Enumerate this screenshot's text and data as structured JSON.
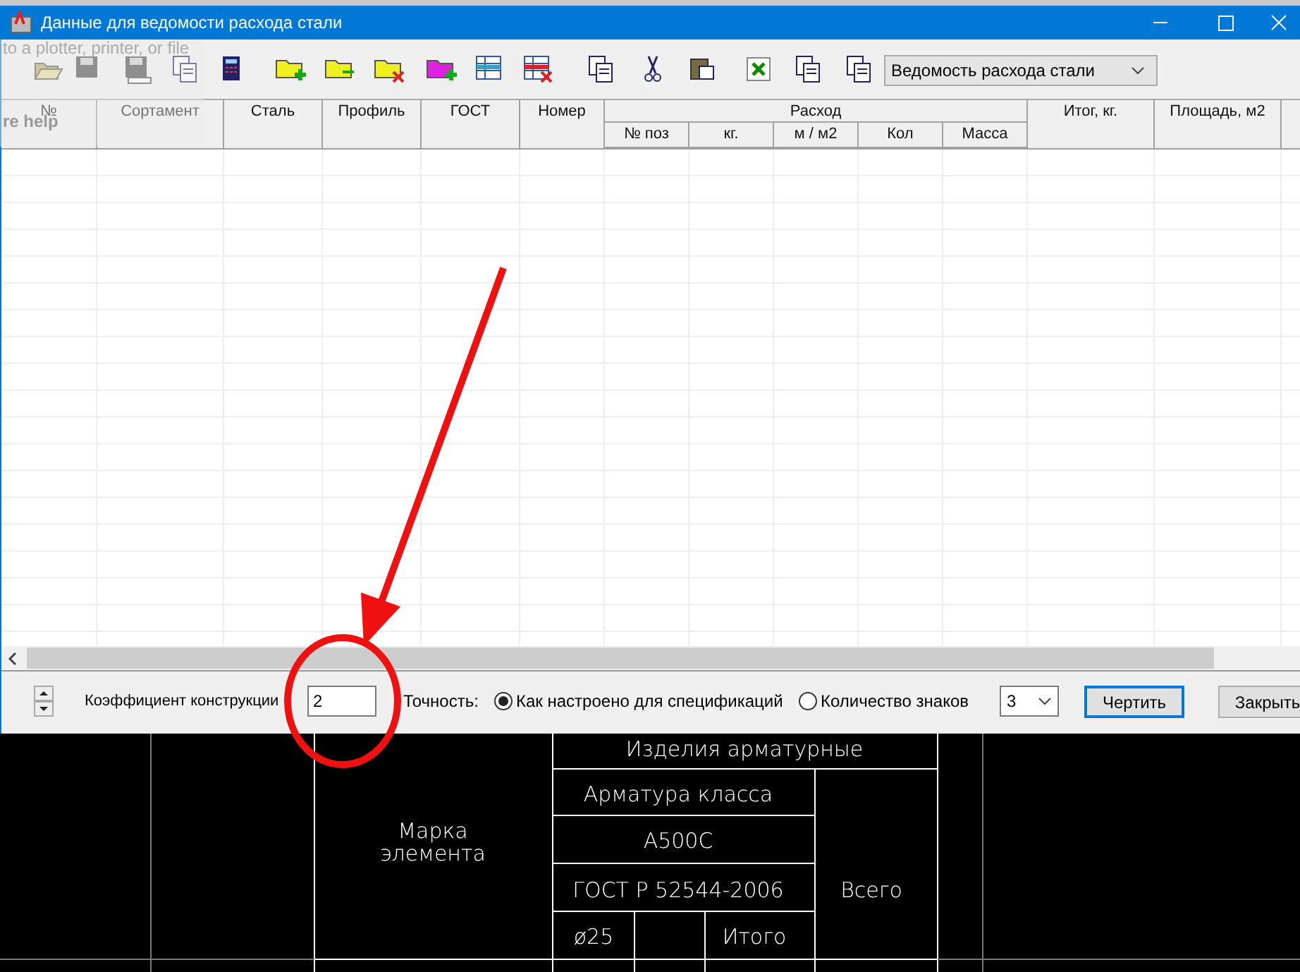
{
  "window": {
    "title": "Данные для ведомости расхода стали"
  },
  "ghost_panel": {
    "texts": [
      "to a plotter, printer, or file",
      "re help"
    ]
  },
  "toolbar": {
    "dropdown": {
      "value": "Ведомость расхода стали"
    }
  },
  "table": {
    "columns": [
      {
        "label": "№"
      },
      {
        "label": "Сортамент"
      },
      {
        "label": "Сталь"
      },
      {
        "label": "Профиль"
      },
      {
        "label": "ГОСТ"
      },
      {
        "label": "Номер"
      },
      {
        "label": "Расход",
        "children": [
          {
            "label": "№ поз"
          },
          {
            "label": "кг."
          },
          {
            "label": "м / м2"
          },
          {
            "label": "Кол"
          },
          {
            "label": "Масса"
          }
        ]
      },
      {
        "label": "Итог, кг."
      },
      {
        "label": "Площадь, м2"
      }
    ]
  },
  "bottom_panel": {
    "coefficient": {
      "label": "Коэффициент конструкции",
      "value": "2"
    },
    "precision_label": "Точность:",
    "options": [
      {
        "label": "Как настроено для спецификаций",
        "selected": true
      },
      {
        "label": "Количество знаков",
        "selected": false
      }
    ],
    "digits": {
      "value": "3"
    },
    "buttons": [
      {
        "label": "Чертить",
        "default": true
      },
      {
        "label": "Закрыть",
        "default": false
      }
    ]
  },
  "drawing": {
    "group_header": "Изделия арматурные",
    "mark_header": [
      "Марка",
      "элемента"
    ],
    "class_label": "Арматура класса",
    "class": "А500С",
    "standard": "ГОСТ Р 52544-2006",
    "total_header": "Всего",
    "diameter": "ø25",
    "subtotal": "Итого"
  }
}
